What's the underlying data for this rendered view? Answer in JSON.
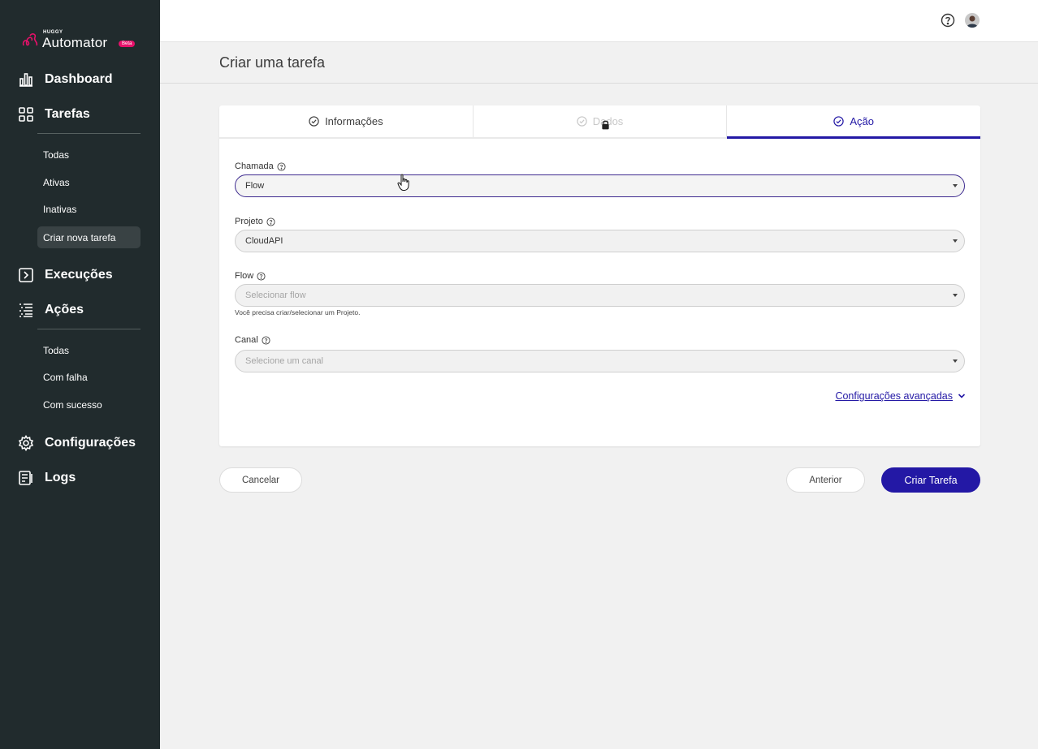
{
  "brand": {
    "small": "HUGGY",
    "name": "Automator",
    "badge": "Beta",
    "accent": "#e6116a"
  },
  "sidebar": {
    "dashboard": "Dashboard",
    "tarefas": "Tarefas",
    "tarefas_items": [
      "Todas",
      "Ativas",
      "Inativas",
      "Criar nova tarefa"
    ],
    "execucoes": "Execuções",
    "acoes": "Ações",
    "acoes_items": [
      "Todas",
      "Com falha",
      "Com sucesso"
    ],
    "configuracoes": "Configurações",
    "logs": "Logs"
  },
  "page": {
    "title": "Criar uma tarefa"
  },
  "tabs": [
    "Informações",
    "Dados",
    "Ação"
  ],
  "form": {
    "chamada": {
      "label": "Chamada",
      "value": "Flow"
    },
    "projeto": {
      "label": "Projeto",
      "value": "CloudAPI"
    },
    "flow": {
      "label": "Flow",
      "placeholder": "Selecionar flow",
      "helper": "Você precisa criar/selecionar um Projeto."
    },
    "canal": {
      "label": "Canal",
      "placeholder": "Selecione um canal"
    },
    "advanced": "Configurações avançadas"
  },
  "buttons": {
    "cancel": "Cancelar",
    "previous": "Anterior",
    "create": "Criar Tarefa"
  },
  "colors": {
    "primary": "#2318a5",
    "sidebar": "#212b2d"
  }
}
